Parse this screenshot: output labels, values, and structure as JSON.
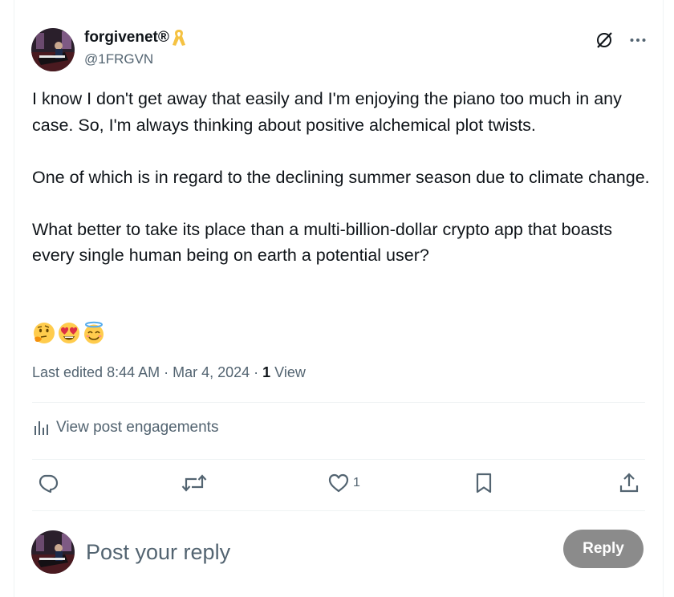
{
  "author": {
    "display_name": "forgivenet®",
    "handle": "@1FRGVN"
  },
  "tweet": {
    "paragraphs": [
      "I know I don't get away that easily and I'm enjoying the piano too much in any case. So, I'm always thinking about positive alchemical plot twists.",
      "One of which is in regard to the declining summer season due to climate change.",
      "What better to take its place than a multi-billion-dollar crypto app that boasts every single human being on earth a potential user?"
    ],
    "emojis": [
      "thinking-face-emoji",
      "heart-eyes-emoji",
      "halo-smile-emoji"
    ]
  },
  "meta": {
    "edited_label": "Last edited 8:44 AM · Mar 4, 2024 · ",
    "views_count": "1",
    "views_label": " View"
  },
  "engagements": {
    "label": "View post engagements"
  },
  "actions": {
    "reply_icon": "reply-icon",
    "repost_icon": "repost-icon",
    "like_icon": "like-icon",
    "like_count": "1",
    "bookmark_icon": "bookmark-icon",
    "share_icon": "share-icon"
  },
  "reply_box": {
    "placeholder": "Post your reply",
    "button_label": "Reply"
  },
  "colors": {
    "text_primary": "#0f1419",
    "text_secondary": "#536471",
    "divider": "#eff3f4",
    "reply_button_disabled": "#8b8b8b",
    "ribbon": "#f5c242"
  }
}
